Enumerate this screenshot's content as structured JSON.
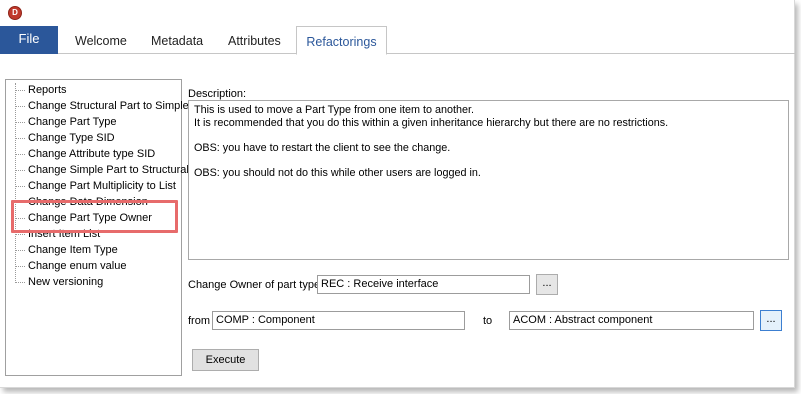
{
  "app": {
    "logo_letter": "D"
  },
  "ribbon": {
    "file_label": "File",
    "tabs": [
      {
        "label": "Welcome"
      },
      {
        "label": "Metadata"
      },
      {
        "label": "Attributes"
      },
      {
        "label": "Refactorings",
        "active": true
      }
    ]
  },
  "tree": {
    "items": [
      {
        "label": "Reports"
      },
      {
        "label": "Change Structural Part to Simple"
      },
      {
        "label": "Change Part Type"
      },
      {
        "label": "Change Type SID"
      },
      {
        "label": "Change Attribute type SID"
      },
      {
        "label": "Change Simple Part to Structural"
      },
      {
        "label": "Change Part Multiplicity to List"
      },
      {
        "label": "Change Data Dimension"
      },
      {
        "label": "Change Part Type Owner",
        "selected": true
      },
      {
        "label": "Insert Item List"
      },
      {
        "label": "Change Item Type"
      },
      {
        "label": "Change enum value"
      },
      {
        "label": "New versioning"
      }
    ]
  },
  "description": {
    "label": "Description:",
    "lines": [
      "This is used to move a Part Type from one item to another.",
      "It is recommended that you do this within a given inheritance hierarchy but there are no restrictions.",
      "OBS: you have to restart the client to see the change.",
      "OBS: you should not do this while other users are logged in."
    ]
  },
  "form": {
    "owner_label": "Change Owner of part type:",
    "owner_value": "REC : Receive interface",
    "browse_label": "...",
    "from_label": "from",
    "from_value": "COMP : Component",
    "to_label": "to",
    "to_value": "ACOM : Abstract component",
    "execute_label": "Execute"
  },
  "colors": {
    "file_tab": "#2b579a",
    "highlight": "#e76b6b",
    "active_tab_text": "#2b579a"
  }
}
